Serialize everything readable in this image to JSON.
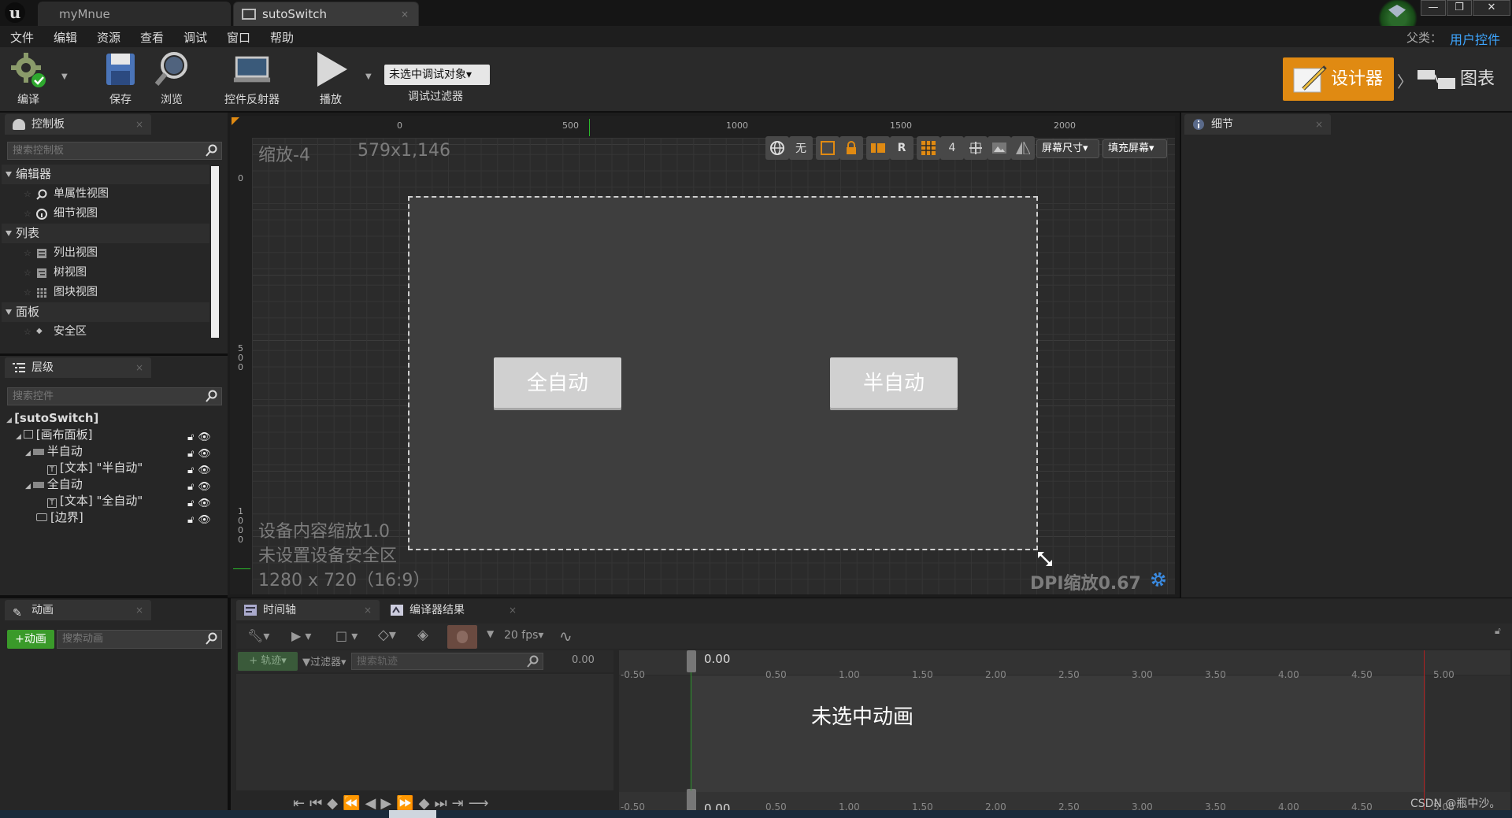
{
  "window": {
    "tabs": [
      {
        "label": "myMnue"
      },
      {
        "label": "sutoSwitch"
      }
    ],
    "parent_class_label": "父类：",
    "parent_class_value": "用户控件",
    "controls": [
      "minimize",
      "restore",
      "close"
    ]
  },
  "menu": [
    "文件",
    "编辑",
    "资源",
    "查看",
    "调试",
    "窗口",
    "帮助"
  ],
  "toolbar": {
    "compile": "编译",
    "save": "保存",
    "browse": "浏览",
    "widget_reflector": "控件反射器",
    "play": "播放",
    "debug_target": "未选中调试对象▾",
    "debug_filter": "调试过滤器",
    "designer": "设计器",
    "graph": "图表"
  },
  "palette": {
    "tab": "控制板",
    "search_placeholder": "搜索控制板",
    "categories": [
      {
        "label": "编辑器",
        "items": [
          "单属性视图",
          "细节视图"
        ]
      },
      {
        "label": "列表",
        "items": [
          "列出视图",
          "树视图",
          "图块视图"
        ]
      },
      {
        "label": "面板",
        "items": [
          "安全区"
        ]
      }
    ]
  },
  "hierarchy": {
    "tab": "层级",
    "search_placeholder": "搜索控件",
    "nodes": [
      {
        "label": "[sutoSwitch]"
      },
      {
        "label": "[画布面板]"
      },
      {
        "label": "半自动"
      },
      {
        "label": "[文本] \"半自动\""
      },
      {
        "label": "全自动"
      },
      {
        "label": "[文本] \"全自动\""
      },
      {
        "label": "[边界]"
      }
    ]
  },
  "details": {
    "tab": "细节"
  },
  "viewport": {
    "zoom": "缩放-4",
    "size": "579x1,146",
    "ruler_h": [
      "0",
      "500",
      "1000",
      "1500",
      "2000"
    ],
    "ruler_v": [
      {
        "label": "0"
      },
      {
        "label": "5\n0\n0"
      },
      {
        "label": "1\n0\n0\n0"
      }
    ],
    "toolbar": {
      "none": "无",
      "r": "R",
      "grid_size": "4",
      "screen_size": "屏幕尺寸▾",
      "fill_screen": "填充屏幕▾"
    },
    "buttons": [
      {
        "label": "全自动"
      },
      {
        "label": "半自动"
      }
    ],
    "info_lines": [
      "设备内容缩放1.0",
      "未设置设备安全区",
      "1280 x 720（16:9）"
    ],
    "dpi": "DPI缩放0.67"
  },
  "animation": {
    "tab": "动画",
    "add_button": "+动画",
    "search_placeholder": "搜索动画"
  },
  "timeline": {
    "tab": "时间轴",
    "compiler_tab": "编译器结果",
    "fps": "20 fps▾",
    "track_button": "+ 轨迹▾",
    "filter_button": "过滤器▾",
    "search_placeholder": "搜索轨迹",
    "current_time": "0.00",
    "playhead_top": "0.00",
    "playhead_bottom": "0.00",
    "ticks": [
      "-0.50",
      "0.50",
      "1.00",
      "1.50",
      "2.00",
      "2.50",
      "3.00",
      "3.50",
      "4.00",
      "4.50",
      "5.00"
    ],
    "empty_message": "未选中动画"
  },
  "watermark": "CSDN @瓶中沙。",
  "colors": {
    "accent": "#e08a12",
    "link": "#3ea6ff",
    "playhead_green": "#2a9a2a",
    "end_red": "#b02020"
  }
}
